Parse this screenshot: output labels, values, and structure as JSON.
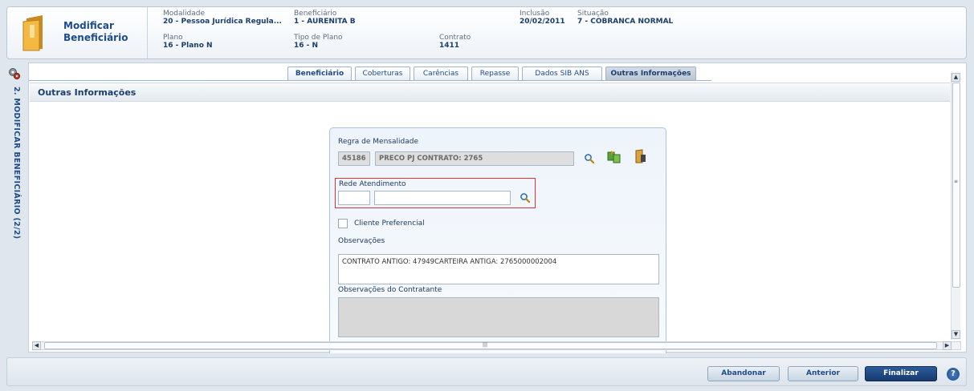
{
  "header": {
    "title": "Modificar Beneficiário",
    "fields": {
      "modalidade": {
        "label": "Modalidade",
        "value": "20 - Pessoa Jurídica Regula..."
      },
      "beneficiario": {
        "label": "Beneficiário",
        "value": "1 - AURENITA B"
      },
      "inclusao": {
        "label": "Inclusão",
        "value": "20/02/2011"
      },
      "situacao": {
        "label": "Situação",
        "value": "7 - COBRANCA NORMAL"
      },
      "plano": {
        "label": "Plano",
        "value": "16 - Plano N"
      },
      "tipo_plano": {
        "label": "Tipo de Plano",
        "value": "16 - N"
      },
      "contrato": {
        "label": "Contrato",
        "value": "1411"
      }
    }
  },
  "rail": {
    "label": "2. MODIFICAR BENEFICIÁRIO (2/2)"
  },
  "tabs": [
    {
      "label": "Beneficiário"
    },
    {
      "label": "Coberturas"
    },
    {
      "label": "Carências"
    },
    {
      "label": "Repasse"
    },
    {
      "label": "Dados SIB ANS"
    },
    {
      "label": "Outras Informações"
    }
  ],
  "section": {
    "title": "Outras Informações"
  },
  "form": {
    "regra_label": "Regra de Mensalidade",
    "regra_code": "45186",
    "regra_desc": "PRECO PJ CONTRATO: 2765",
    "rede_label": "Rede Atendimento",
    "rede_code": "",
    "rede_desc": "",
    "cliente_pref_label": "Cliente Preferencial",
    "cliente_pref_checked": false,
    "obs_label": "Observações",
    "obs_value": "CONTRATO ANTIGO: 47949CARTEIRA ANTIGA: 2765000002004",
    "obs_contratante_label": "Observações do Contratante",
    "obs_contratante_value": ""
  },
  "footer": {
    "abandonar": "Abandonar",
    "anterior": "Anterior",
    "finalizar": "Finalizar",
    "help": "?"
  },
  "colors": {
    "accent": "#1e4c8a",
    "primary_button": "#163a6e",
    "highlight_border": "#dd3333"
  }
}
